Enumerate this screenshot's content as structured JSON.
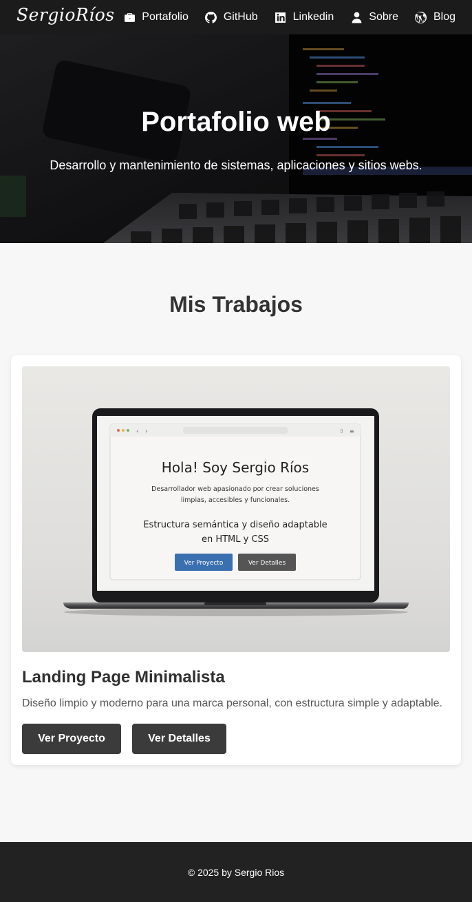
{
  "brand": {
    "logo": "SergioRíos"
  },
  "nav": {
    "items": [
      {
        "label": "Portafolio",
        "icon": "briefcase-icon"
      },
      {
        "label": "GitHub",
        "icon": "github-icon"
      },
      {
        "label": "Linkedin",
        "icon": "linkedin-icon"
      },
      {
        "label": "Sobre",
        "icon": "user-icon"
      },
      {
        "label": "Blog",
        "icon": "wordpress-icon"
      }
    ]
  },
  "hero": {
    "title": "Portafolio web",
    "subtitle": "Desarrollo y mantenimiento de sistemas, aplicaciones y sitios webs."
  },
  "section": {
    "title": "Mis Trabajos"
  },
  "project": {
    "title": "Landing Page Minimalista",
    "description": "Diseño limpio y moderno para una marca personal, con estructura simple y adaptable.",
    "view_button": "Ver Proyecto",
    "details_button": "Ver Detalles",
    "mockup": {
      "heading": "Hola! Soy Sergio Ríos",
      "text_line1": "Desarrollador web apasionado por crear soluciones",
      "text_line2": "limpias, accesibles y funcionales.",
      "sub_line1": "Estructura semántica y diseño adaptable",
      "sub_line2": "en HTML y CSS",
      "btn1": "Ver Proyecto",
      "btn2": "Ver Detalles"
    }
  },
  "footer": {
    "text": "© 2025 by Sergio Rios"
  },
  "colors": {
    "navbar": "#1b1b1b",
    "background": "#f7f7f7",
    "button": "#3b3b3b",
    "footer": "#222222",
    "mockup_primary_button": "#3a6fb0"
  }
}
